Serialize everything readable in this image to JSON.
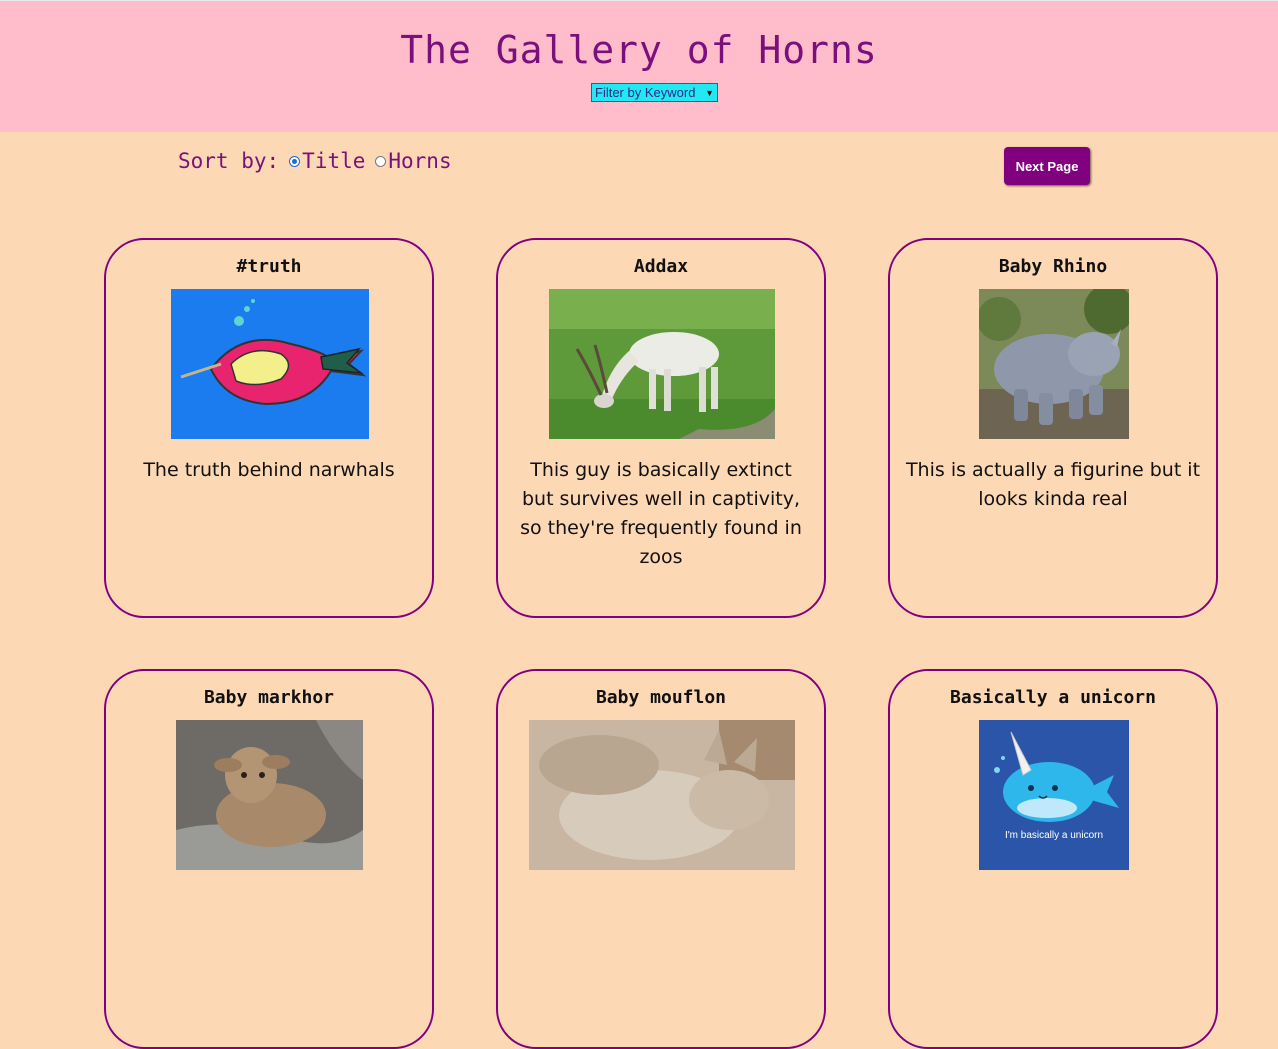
{
  "header": {
    "title": "The Gallery of Horns",
    "filter_label": "Filter by Keyword"
  },
  "sort": {
    "label": "Sort by:",
    "options": [
      {
        "label": "Title",
        "selected": true
      },
      {
        "label": "Horns",
        "selected": false
      }
    ]
  },
  "next_button": "Next Page",
  "colors": {
    "accent": "#800080",
    "page_bg": "#fdd8b5",
    "header_bg": "#ffbccb",
    "filter_bg": "#22e8f2"
  },
  "cards": [
    {
      "title": "#truth",
      "description": "The truth behind narwhals",
      "image": "cartoon-narwhal-image"
    },
    {
      "title": "Addax",
      "description": "This guy is basically extinct but survives well in captivity, so they're frequently found in zoos",
      "image": "addax-photo"
    },
    {
      "title": "Baby Rhino",
      "description": "This is actually a figurine but it looks kinda real",
      "image": "rhino-figurine-photo"
    },
    {
      "title": "Baby markhor",
      "description": "",
      "image": "baby-markhor-photo"
    },
    {
      "title": "Baby mouflon",
      "description": "",
      "image": "baby-mouflon-photo"
    },
    {
      "title": "Basically a unicorn",
      "description": "",
      "image": "cartoon-narwhal-image",
      "image_caption": "I'm basically a unicorn"
    }
  ]
}
